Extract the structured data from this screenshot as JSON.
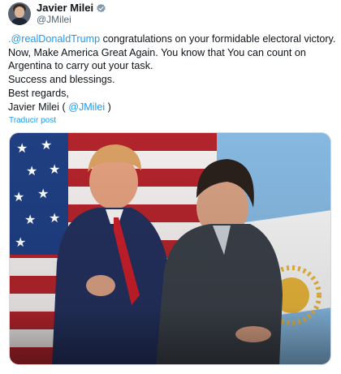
{
  "author": {
    "display_name": "Javier Milei",
    "handle": "@JMilei",
    "avatar_icon": "avatar-photo",
    "verified_icon": "verified-badge-icon"
  },
  "tweet": {
    "mention": ".@realDonaldTrump",
    "line1_rest": " congratulations on your formidable electoral victory.",
    "line2": "Now, Make America Great Again. You know that You can count on",
    "line3": "Argentina to carry out your task.",
    "line4": "Success and blessings.",
    "line5": "Best regards,",
    "signature_name": "Javier Milei ( ",
    "signature_handle": "@JMilei",
    "signature_close": " )",
    "translate_label": "Traducir post"
  },
  "media": {
    "description_icon": "photo-two-men-embracing-flags"
  },
  "colors": {
    "link": "#1d9bf0",
    "text": "#0f1419",
    "secondary": "#536471",
    "verified": "#829aab"
  }
}
